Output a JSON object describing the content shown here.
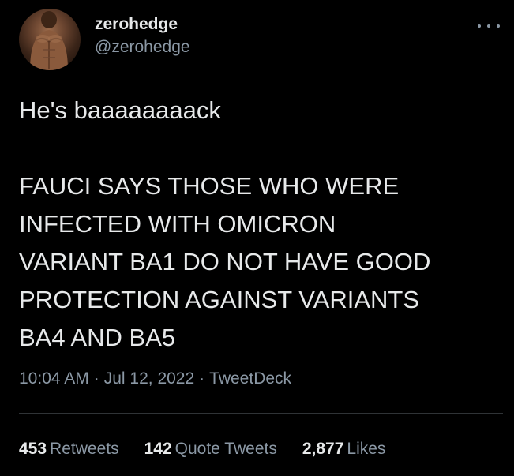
{
  "author": {
    "display_name": "zerohedge",
    "handle": "@zerohedge",
    "avatar_icon": "profile-photo"
  },
  "tweet": {
    "lines": [
      "He's baaaaaaaack",
      "FAUCI SAYS THOSE WHO WERE",
      "INFECTED WITH OMICRON",
      "VARIANT BA1 DO NOT HAVE GOOD",
      "PROTECTION AGAINST VARIANTS",
      "BA4 AND BA5"
    ]
  },
  "meta": {
    "time": "10:04 AM",
    "date": "Jul 12, 2022",
    "source": "TweetDeck",
    "separator": "·"
  },
  "stats": {
    "retweets_count": "453",
    "retweets_label": "Retweets",
    "quote_count": "142",
    "quote_label": "Quote Tweets",
    "likes_count": "2,877",
    "likes_label": "Likes"
  },
  "colors": {
    "background": "#000000",
    "primary_text": "#e7e9ea",
    "secondary_text": "#8b98a5",
    "divider": "#2f3336"
  }
}
